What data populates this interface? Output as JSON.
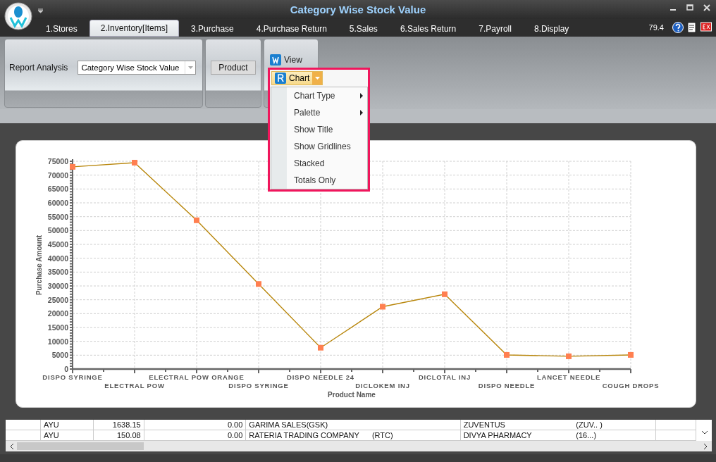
{
  "window": {
    "title": "Category Wise Stock Value"
  },
  "tabs": [
    {
      "label": "1.Stores",
      "selected": false
    },
    {
      "label": "2.Inventory[Items]",
      "selected": true
    },
    {
      "label": "3.Purchase",
      "selected": false
    },
    {
      "label": "4.Purchase Return",
      "selected": false
    },
    {
      "label": "5.Sales",
      "selected": false
    },
    {
      "label": "6.Sales Return",
      "selected": false
    },
    {
      "label": "7.Payroll",
      "selected": false
    },
    {
      "label": "8.Display",
      "selected": false
    }
  ],
  "version": "79.4",
  "ribbon": {
    "report_label": "Report Analysis",
    "report_select": {
      "value": "Category Wise Stock Value"
    },
    "product_button": "Product",
    "view_button": "View",
    "chart_button": "Chart"
  },
  "chart_menu": {
    "items": [
      {
        "label": "Chart Type",
        "submenu": true
      },
      {
        "label": "Palette",
        "submenu": true
      },
      {
        "label": "Show Title",
        "submenu": false
      },
      {
        "label": "Show Gridlines",
        "submenu": false
      },
      {
        "label": "Stacked",
        "submenu": false
      },
      {
        "label": "Totals Only",
        "submenu": false
      }
    ]
  },
  "chart_data": {
    "type": "line",
    "xlabel": "Product Name",
    "ylabel": "Purchase Amount",
    "categories": [
      "DISPO SYRINGE",
      "ELECTRAL POW",
      "ELECTRAL POW ORANGE",
      "DISPO SYRINGE",
      "DISPO NEEDLE 24",
      "DICLOKEM INJ",
      "DICLOTAL INJ",
      "DISPO NEEDLE",
      "LANCET NEEDLE",
      "COUGH DROPS"
    ],
    "grid": true,
    "series": [
      {
        "color": "#b8860b",
        "marker": "square",
        "values": [
          73000,
          74500,
          53700,
          30700,
          7700,
          22500,
          27000,
          5100,
          4600,
          5100
        ]
      }
    ],
    "ylim": [
      0,
      75000
    ],
    "yticks": [
      0,
      5000,
      10000,
      15000,
      20000,
      25000,
      30000,
      35000,
      40000,
      45000,
      50000,
      55000,
      60000,
      65000,
      70000,
      75000
    ]
  },
  "table": {
    "rows": [
      {
        "cells": [
          "",
          "AYU",
          "1638.15",
          "0.00",
          "GARIMA SALES(GSK)",
          "ZUVENTUS",
          "(ZUV.. )",
          ""
        ]
      },
      {
        "cells": [
          "",
          "AYU",
          "150.08",
          "0.00",
          "RATERIA TRADING COMPANY      (RTC)",
          "DIVYA PHARMACY",
          "(16...)",
          ""
        ]
      }
    ]
  }
}
